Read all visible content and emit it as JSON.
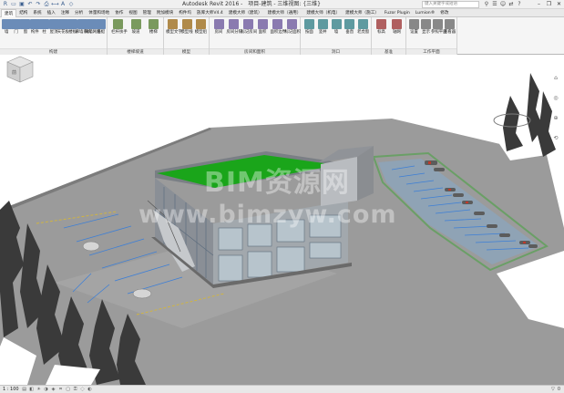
{
  "titlebar": {
    "app_name": "Autodesk Revit 2016 -",
    "document": "项目-建筑 - 三维视图: {三维}",
    "search_placeholder": "键入关键字或短语",
    "qat_icons": [
      "revit-logo-icon",
      "open-icon",
      "save-icon",
      "undo-icon",
      "redo-icon",
      "print-icon",
      "measure-icon",
      "text-icon",
      "view-3d-icon"
    ],
    "window_controls": [
      "minimize-icon",
      "restore-icon",
      "close-icon"
    ]
  },
  "tabs": [
    {
      "label": "建筑",
      "active": true
    },
    {
      "label": "结构",
      "active": false
    },
    {
      "label": "系统",
      "active": false
    },
    {
      "label": "插入",
      "active": false
    },
    {
      "label": "注释",
      "active": false
    },
    {
      "label": "分析",
      "active": false
    },
    {
      "label": "体量和场地",
      "active": false
    },
    {
      "label": "协作",
      "active": false
    },
    {
      "label": "视图",
      "active": false
    },
    {
      "label": "管理",
      "active": false
    },
    {
      "label": "附加模块",
      "active": false
    },
    {
      "label": "构件坞",
      "active": false
    },
    {
      "label": "族库大师V4.4",
      "active": false
    },
    {
      "label": "建模大师（建筑）",
      "active": false
    },
    {
      "label": "建模大师（通用）",
      "active": false
    },
    {
      "label": "建模大师（机电）",
      "active": false
    },
    {
      "label": "建模大师（施工）",
      "active": false
    },
    {
      "label": "Fuzor Plugin",
      "active": false
    },
    {
      "label": "Lumion®",
      "active": false
    },
    {
      "label": "修改",
      "active": false
    }
  ],
  "ribbon": {
    "groups": [
      {
        "label": "构建",
        "buttons": [
          "墙",
          "门",
          "窗",
          "构件",
          "柱",
          "屋顶",
          "天花板",
          "楼板",
          "幕墙系统",
          "幕墙网格",
          "竖梃"
        ]
      },
      {
        "label": "楼梯坡道",
        "buttons": [
          "栏杆扶手",
          "坡道",
          "楼梯"
        ]
      },
      {
        "label": "模型",
        "buttons": [
          "模型文字",
          "模型线",
          "模型组"
        ]
      },
      {
        "label": "房间和面积",
        "buttons": [
          "房间",
          "房间分隔",
          "标记房间",
          "面积",
          "面积边界",
          "标记面积"
        ]
      },
      {
        "label": "洞口",
        "buttons": [
          "按面",
          "竖井",
          "墙",
          "垂直",
          "老虎窗"
        ]
      },
      {
        "label": "基准",
        "buttons": [
          "标高",
          "轴网"
        ]
      },
      {
        "label": "工作平面",
        "buttons": [
          "设置",
          "显示",
          "参照平面",
          "查看器"
        ]
      }
    ]
  },
  "viewport": {
    "watermark_line1": "BIM资源网",
    "watermark_line2": "www.bimzyw.com",
    "viewcube_label": "前"
  },
  "statusbar": {
    "scale": "1 : 100",
    "icons": [
      "detail-level-icon",
      "visual-style-icon",
      "sun-path-icon",
      "shadows-icon",
      "render-icon",
      "crop-icon",
      "crop-visibility-icon",
      "lock-3d-icon",
      "temp-hide-icon",
      "reveal-hidden-icon"
    ],
    "right_text": "0"
  },
  "colors": {
    "roof_green": "#1aa51a",
    "ground_grey": "#9a9a9a",
    "parking_line_blue": "#3d7fd6",
    "tree_dark": "#3a3a3a",
    "ribbon_bg": "#f5f5f5"
  }
}
